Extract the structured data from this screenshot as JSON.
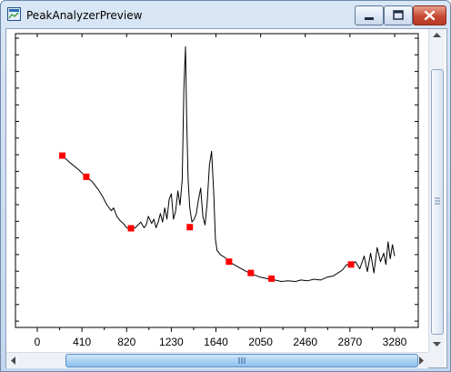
{
  "window": {
    "title": "PeakAnalyzerPreview",
    "controls": {
      "minimize": "minimize",
      "maximize": "maximize",
      "close": "close"
    }
  },
  "chart_data": {
    "type": "line",
    "xlim": [
      0,
      3280
    ],
    "x_ticks": [
      0,
      410,
      820,
      1230,
      1640,
      2050,
      2460,
      2870,
      3280
    ],
    "x_tick_labels": [
      "0",
      "410",
      "820",
      "1230",
      "1640",
      "2050",
      "2460",
      "2870",
      "3280"
    ],
    "ylim": [
      0,
      1
    ],
    "grid": false,
    "series": [
      {
        "points": [
          [
            230,
            0.585
          ],
          [
            300,
            0.56
          ],
          [
            380,
            0.535
          ],
          [
            420,
            0.52
          ],
          [
            450,
            0.51
          ],
          [
            500,
            0.495
          ],
          [
            560,
            0.465
          ],
          [
            600,
            0.44
          ],
          [
            640,
            0.41
          ],
          [
            680,
            0.39
          ],
          [
            700,
            0.4
          ],
          [
            730,
            0.37
          ],
          [
            760,
            0.355
          ],
          [
            790,
            0.345
          ],
          [
            820,
            0.33
          ],
          [
            850,
            0.325
          ],
          [
            900,
            0.33
          ],
          [
            950,
            0.35
          ],
          [
            980,
            0.33
          ],
          [
            1000,
            0.34
          ],
          [
            1020,
            0.37
          ],
          [
            1050,
            0.345
          ],
          [
            1070,
            0.36
          ],
          [
            1090,
            0.33
          ],
          [
            1110,
            0.35
          ],
          [
            1130,
            0.38
          ],
          [
            1150,
            0.35
          ],
          [
            1170,
            0.4
          ],
          [
            1190,
            0.36
          ],
          [
            1210,
            0.43
          ],
          [
            1230,
            0.45
          ],
          [
            1250,
            0.36
          ],
          [
            1270,
            0.39
          ],
          [
            1290,
            0.46
          ],
          [
            1310,
            0.41
          ],
          [
            1330,
            0.5
          ],
          [
            1345,
            0.82
          ],
          [
            1360,
            0.97
          ],
          [
            1372,
            0.7
          ],
          [
            1385,
            0.5
          ],
          [
            1400,
            0.4
          ],
          [
            1420,
            0.35
          ],
          [
            1440,
            0.36
          ],
          [
            1460,
            0.38
          ],
          [
            1480,
            0.43
          ],
          [
            1500,
            0.47
          ],
          [
            1520,
            0.37
          ],
          [
            1540,
            0.34
          ],
          [
            1560,
            0.42
          ],
          [
            1580,
            0.55
          ],
          [
            1600,
            0.6
          ],
          [
            1620,
            0.45
          ],
          [
            1635,
            0.29
          ],
          [
            1650,
            0.25
          ],
          [
            1680,
            0.235
          ],
          [
            1720,
            0.225
          ],
          [
            1780,
            0.205
          ],
          [
            1850,
            0.19
          ],
          [
            1920,
            0.175
          ],
          [
            1980,
            0.165
          ],
          [
            2050,
            0.155
          ],
          [
            2110,
            0.15
          ],
          [
            2180,
            0.145
          ],
          [
            2240,
            0.14
          ],
          [
            2300,
            0.142
          ],
          [
            2370,
            0.14
          ],
          [
            2420,
            0.145
          ],
          [
            2480,
            0.142
          ],
          [
            2540,
            0.148
          ],
          [
            2600,
            0.145
          ],
          [
            2660,
            0.155
          ],
          [
            2720,
            0.16
          ],
          [
            2760,
            0.17
          ],
          [
            2800,
            0.18
          ],
          [
            2840,
            0.2
          ],
          [
            2880,
            0.195
          ],
          [
            2920,
            0.21
          ],
          [
            2960,
            0.185
          ],
          [
            3000,
            0.23
          ],
          [
            3030,
            0.175
          ],
          [
            3060,
            0.24
          ],
          [
            3090,
            0.17
          ],
          [
            3120,
            0.26
          ],
          [
            3150,
            0.21
          ],
          [
            3180,
            0.24
          ],
          [
            3200,
            0.2
          ],
          [
            3220,
            0.28
          ],
          [
            3240,
            0.22
          ],
          [
            3260,
            0.27
          ],
          [
            3280,
            0.23
          ]
        ]
      }
    ],
    "markers": [
      [
        230,
        0.585
      ],
      [
        450,
        0.51
      ],
      [
        860,
        0.328
      ],
      [
        1400,
        0.332
      ],
      [
        1760,
        0.21
      ],
      [
        1960,
        0.17
      ],
      [
        2150,
        0.15
      ],
      [
        2880,
        0.2
      ]
    ],
    "colors": {
      "line": "#000000",
      "marker": "#ff0000"
    }
  }
}
